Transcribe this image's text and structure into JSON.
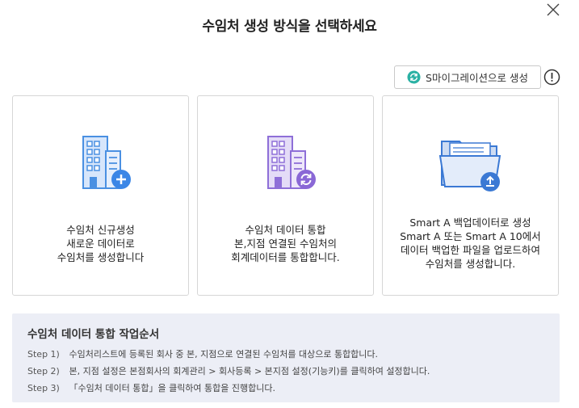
{
  "dialog": {
    "title": "수임처 생성 방식을 선택하세요",
    "migrate_button": "S마이그레이션으로 생성"
  },
  "cards": [
    {
      "heading": "수임처 신규생성",
      "lines": [
        "새로운 데이터로",
        "수임처를 생성합니다"
      ]
    },
    {
      "heading": "수임처 데이터 통합",
      "lines": [
        "본,지점 연결된 수임처의",
        "회계데이터를 통합합니다."
      ]
    },
    {
      "heading": "Smart A 백업데이터로 생성",
      "lines": [
        "Smart A 또는 Smart A 10에서",
        "데이터 백업한 파일을 업로드하여",
        "수임처를 생성합니다."
      ]
    }
  ],
  "steps": {
    "title": "수임처 데이터 통합 작업순서",
    "items": [
      {
        "label": "Step 1)",
        "text": "수임처리스트에 등록된 회사 중 본, 지점으로 연결된 수임처를 대상으로 통합합니다."
      },
      {
        "label": "Step 2)",
        "text": "본, 지점 설정은 본점회사의 회계관리 > 회사등록 > 본지점 설정(기능키)를 클릭하여 설정합니다."
      },
      {
        "label": "Step 3)",
        "text": "「수임처 데이터 통합」을 클릭하여 통합을 진행합니다."
      }
    ]
  },
  "colors": {
    "card1_accent": "#4a90e2",
    "card2_accent": "#8e6fd8",
    "card3_accent": "#3b79d4",
    "steps_bg": "#eceef6",
    "migrate_icon": "#2bb1a4"
  },
  "icons": {
    "close": "close-icon",
    "migrate": "refresh-icon",
    "info": "info-icon",
    "card1": "building-add-icon",
    "card2": "building-sync-icon",
    "card3": "folder-upload-icon"
  }
}
